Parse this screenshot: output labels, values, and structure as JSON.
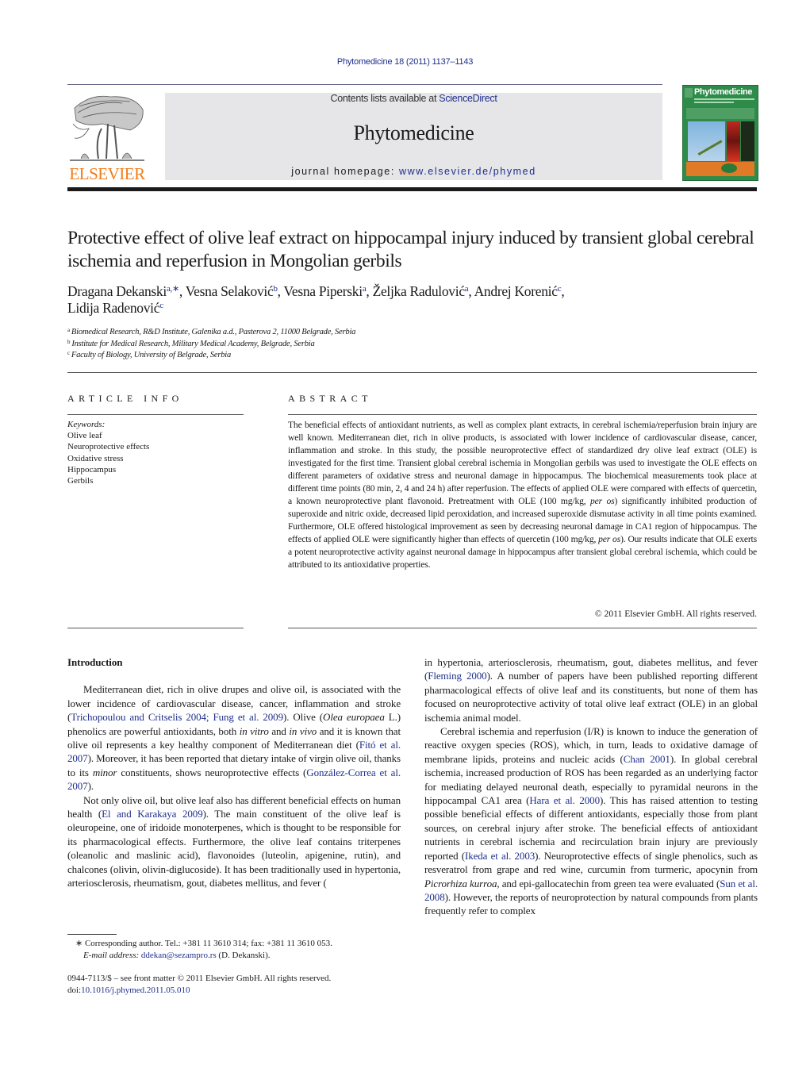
{
  "header": {
    "citation": "Phytomedicine 18 (2011) 1137–1143",
    "contents_prefix": "Contents lists available at ",
    "contents_link": "ScienceDirect",
    "journal_name": "Phytomedicine",
    "homepage_prefix": "journal homepage: ",
    "homepage_link": "www.elsevier.de/phymed",
    "publisher_logo_text": "ELSEVIER",
    "cover_title": "Phytomedicine",
    "colors": {
      "link": "#1f2f8c",
      "elsevier_orange": "#f07c1a",
      "masthead_bg": "#e6e6e8",
      "cover_green": "#2e8b4a"
    }
  },
  "article": {
    "title": "Protective effect of olive leaf extract on hippocampal injury induced by transient global cerebral ischemia and reperfusion in Mongolian gerbils",
    "authors": [
      {
        "name": "Dragana Dekanski",
        "sup": "a,∗",
        "sep": ", "
      },
      {
        "name": "Vesna Selaković",
        "sup": "b",
        "sep": ", "
      },
      {
        "name": "Vesna Piperski",
        "sup": "a",
        "sep": ", "
      },
      {
        "name": "Željka Radulović",
        "sup": "a",
        "sep": ", "
      },
      {
        "name": "Andrej Korenić",
        "sup": "c",
        "sep": ","
      },
      {
        "name": "Lidija Radenović",
        "sup": "c",
        "sep": ""
      }
    ],
    "affiliations": [
      {
        "label": "a",
        "text": "Biomedical Research, R&D Institute, Galenika a.d., Pasterova 2, 11000 Belgrade, Serbia"
      },
      {
        "label": "b",
        "text": "Institute for Medical Research, Military Medical Academy, Belgrade, Serbia"
      },
      {
        "label": "c",
        "text": "Faculty of Biology, University of Belgrade, Serbia"
      }
    ]
  },
  "article_info": {
    "heading": "ARTICLE INFO",
    "keywords_label": "Keywords:",
    "keywords": [
      "Olive leaf",
      "Neuroprotective effects",
      "Oxidative stress",
      "Hippocampus",
      "Gerbils"
    ]
  },
  "abstract": {
    "heading": "ABSTRACT",
    "part1": "The beneficial effects of antioxidant nutrients, as well as complex plant extracts, in cerebral ischemia/reperfusion brain injury are well known. Mediterranean diet, rich in olive products, is asso­ciated with lower incidence of cardiovascular disease, cancer, inflammation and stroke. In this study, the possible neuroprotective effect of standardized dry olive leaf extract (OLE) is investigated for the first time. Transient global cerebral ischemia in Mongolian gerbils was used to investigate the OLE effects on different parameters of oxidative stress and neuronal damage in hippocampus. The biochemical measure­ments took place at different time points (80 min, 2, 4 and 24 h) after reperfusion. The effects of applied OLE were compared with effects of quercetin, a known neuroprotective plant flavonoid. Pretreatment with OLE (100 mg/kg, ",
    "italic1": "per os",
    "part2": ") significantly inhibited production of superoxide and nitric oxide, decreased lipid peroxidation, and increased superoxide dismutase activity in all time points examined. Further­more, OLE offered histological improvement as seen by decreasing neuronal damage in CA1 region of hippocampus. The effects of applied OLE were significantly higher than effects of quercetin (100 mg/kg, ",
    "italic2": "per os",
    "part3": "). Our results indicate that OLE exerts a potent neuroprotective activity against neuronal damage in hippocampus after transient global cerebral ischemia, which could be attributed to its antioxidative properties.",
    "copyright": "© 2011 Elsevier GmbH. All rights reserved."
  },
  "body": {
    "intro_heading": "Introduction",
    "p1": {
      "t1": "Mediterranean diet, rich in olive drupes and olive oil, is asso­ciated with the lower incidence of cardiovascular disease, cancer, inflammation and stroke (",
      "ref1": "Trichopoulou and Critselis 2004; Fung et al. 2009",
      "t2": "). Olive (",
      "i1": "Olea europaea",
      "t3": " L.) phenolics are powerful antiox­idants, both ",
      "i2": "in vitro",
      "t4": " and ",
      "i3": "in vivo",
      "t5": " and it is known that olive oil represents a key healthy component of Mediterranean diet (",
      "ref2": "Fitó et al. 2007",
      "t6": "). Moreover, it has been reported that dietary intake of virgin olive oil, thanks to its ",
      "i4": "minor",
      "t7": " constituents, shows neuropro­tective effects (",
      "ref3": "González-Correa et al. 2007",
      "t8": ")."
    },
    "p2": {
      "t1": "Not only olive oil, but olive leaf also has different benefi­cial effects on human health (",
      "ref1": "El and Karakaya 2009",
      "t2": "). The main constituent of the olive leaf is oleuropeine, one of iridoide monoter­penes, which is thought to be responsible for its pharmacological effects. Furthermore, the olive leaf contains triterpenes (oleano­lic and maslinic acid), flavonoides (luteolin, apigenine, rutin), and chalcones (olivin, olivin-diglucoside). It has been traditionally used in hypertonia, arteriosclerosis, rheumatism, gout, diabetes mel­litus, and fever (",
      "ref2": "Fleming 2000",
      "t3": "). A number of papers have been published reporting different pharmacological effects of olive leaf and its constituents, but none of them has focused on neuroprotec­tive activity of total olive leaf extract (OLE) in an global ischemia animal model."
    },
    "p3": {
      "t1": "Cerebral ischemia and reperfusion (I/R) is known to induce the generation of reactive oxygen species (ROS), which, in turn, leads to oxidative damage of membrane lipids, proteins and nucleic acids (",
      "ref1": "Chan 2001",
      "t2": "). In global cerebral ischemia, increased production of ROS has been regarded as an underlying factor for mediating delayed neuronal death, especially to pyramidal neurons in the hippocampal CA1 area (",
      "ref2": "Hara et al. 2000",
      "t3": "). This has raised atten­tion to testing possible beneficial effects of different antioxidants, especially those from plant sources, on cerebral injury after stroke. The beneficial effects of antioxidant nutrients in cerebral ischemia and recirculation brain injury are previously reported (",
      "ref3": "Ikeda et al. 2003",
      "t4": "). Neuroprotective effects of single phenolics, such as resver­atrol from grape and red wine, curcumin from turmeric, apocynin from ",
      "i1": "Picrorhiza kurroa",
      "t5": ", and epi-gallocatechin from green tea were evaluated (",
      "ref4": "Sun et al. 2008",
      "t6": "). However, the reports of neuroprotec­tion by natural compounds from plants frequently refer to complex"
    }
  },
  "footnotes": {
    "star": "∗",
    "corresponding": "Corresponding author. Tel.: +381 11 3610 314; fax: +381 11 3610 053.",
    "email_label": "E-mail address:",
    "email": "ddekan@sezampro.rs",
    "email_suffix": " (D. Dekanski).",
    "front_matter": "0944-7113/$ – see front matter © 2011 Elsevier GmbH. All rights reserved.",
    "doi_prefix": "doi:",
    "doi": "10.1016/j.phymed.2011.05.010"
  }
}
